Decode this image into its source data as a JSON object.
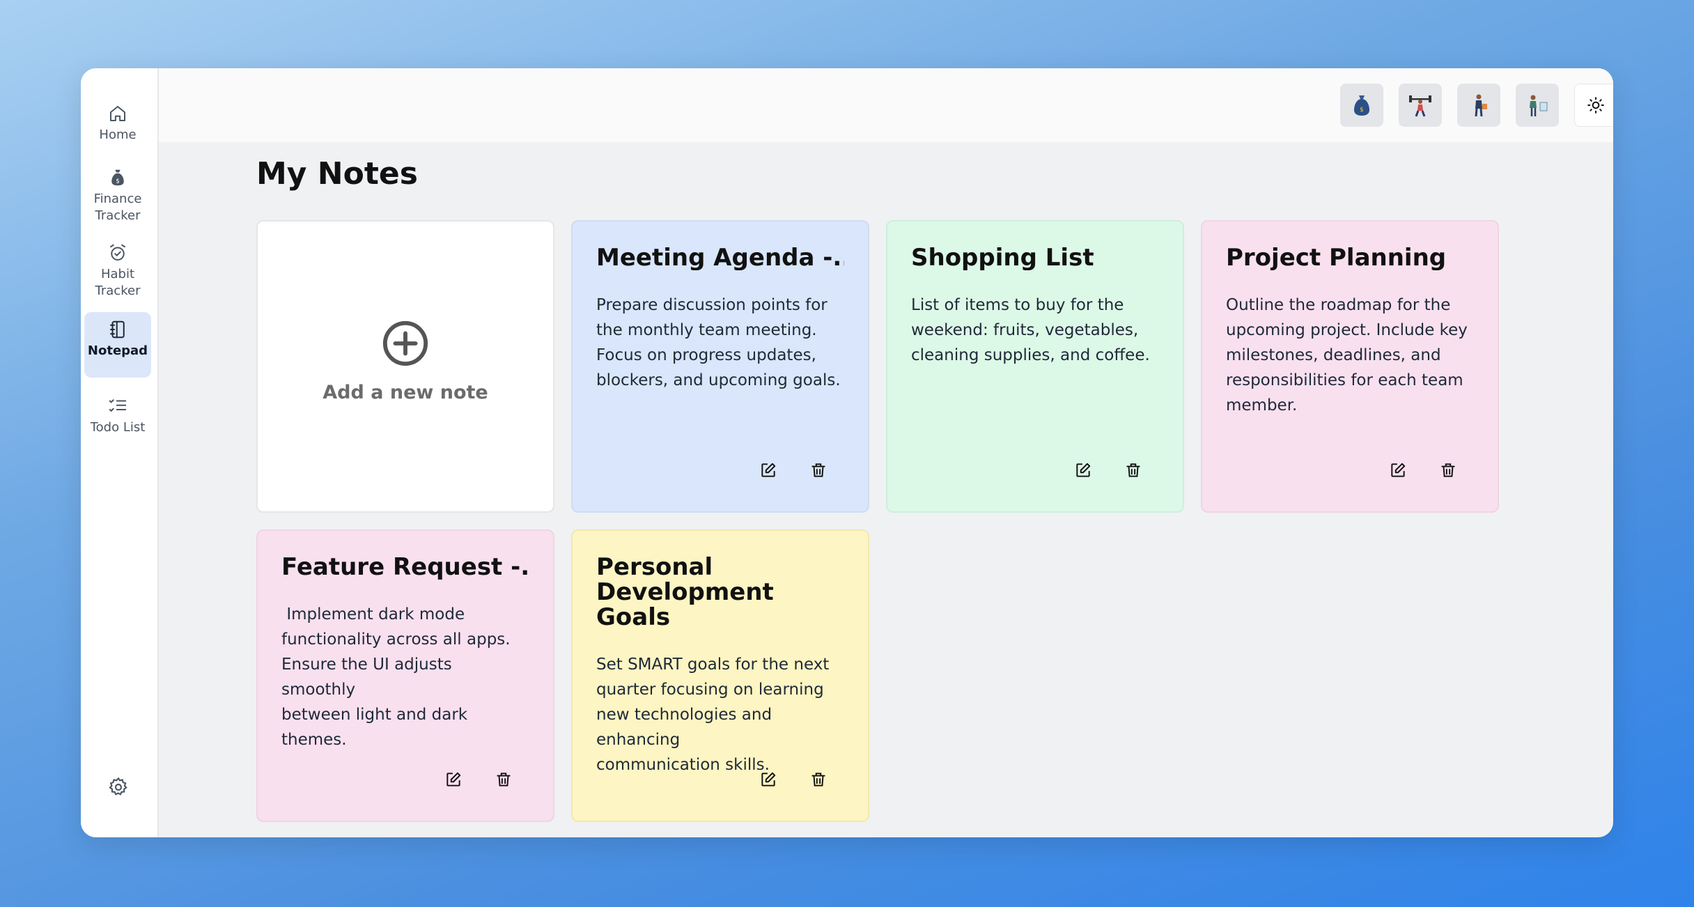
{
  "sidebar": {
    "items": [
      {
        "label": "Home",
        "icon": "home-icon"
      },
      {
        "label": "Finance\nTracker",
        "icon": "money-bag-icon"
      },
      {
        "label": "Habit\nTracker",
        "icon": "alarm-clock-icon"
      },
      {
        "label": "Notepad",
        "icon": "notebook-icon",
        "active": true
      },
      {
        "label": "Todo List",
        "icon": "checklist-icon"
      }
    ],
    "settings_icon": "gear-icon"
  },
  "topbar": {
    "app_icons": [
      "finance-avatar-icon",
      "fitness-avatar-icon",
      "shopping-avatar-icon",
      "notes-avatar-icon"
    ],
    "theme_icon": "sun-icon",
    "profile_icon": "user-avatar"
  },
  "page": {
    "title": "My Notes"
  },
  "add_note": {
    "label": "Add a new note"
  },
  "notes": [
    {
      "title": "Meeting Agenda -...",
      "body": "Prepare discussion points for\nthe monthly team meeting.\nFocus on progress updates,\nblockers, and upcoming goals.",
      "color": "#d9e6fb"
    },
    {
      "title": "Shopping List",
      "body": "List of items to buy for the\nweekend: fruits, vegetables,\ncleaning supplies, and coffee.",
      "color": "#dcf8e7"
    },
    {
      "title": "Project Planning",
      "body": "Outline the roadmap for the\nupcoming project. Include key\nmilestones, deadlines, and\nresponsibilities for each team\nmember.",
      "color": "#f9e0ef"
    },
    {
      "title": "Feature Request -...",
      "body": " Implement dark mode\nfunctionality across all apps.\nEnsure the UI adjusts smoothly\nbetween light and dark themes.",
      "color": "#f9e0ef"
    },
    {
      "title": "Personal\nDevelopment Goals",
      "body": "Set SMART goals for the next\nquarter focusing on learning\nnew technologies and enhancing\ncommunication skills.",
      "color": "#fdf5c3"
    }
  ],
  "colors": {
    "accent": "#dbe7f9",
    "background": "#f0f1f3"
  }
}
